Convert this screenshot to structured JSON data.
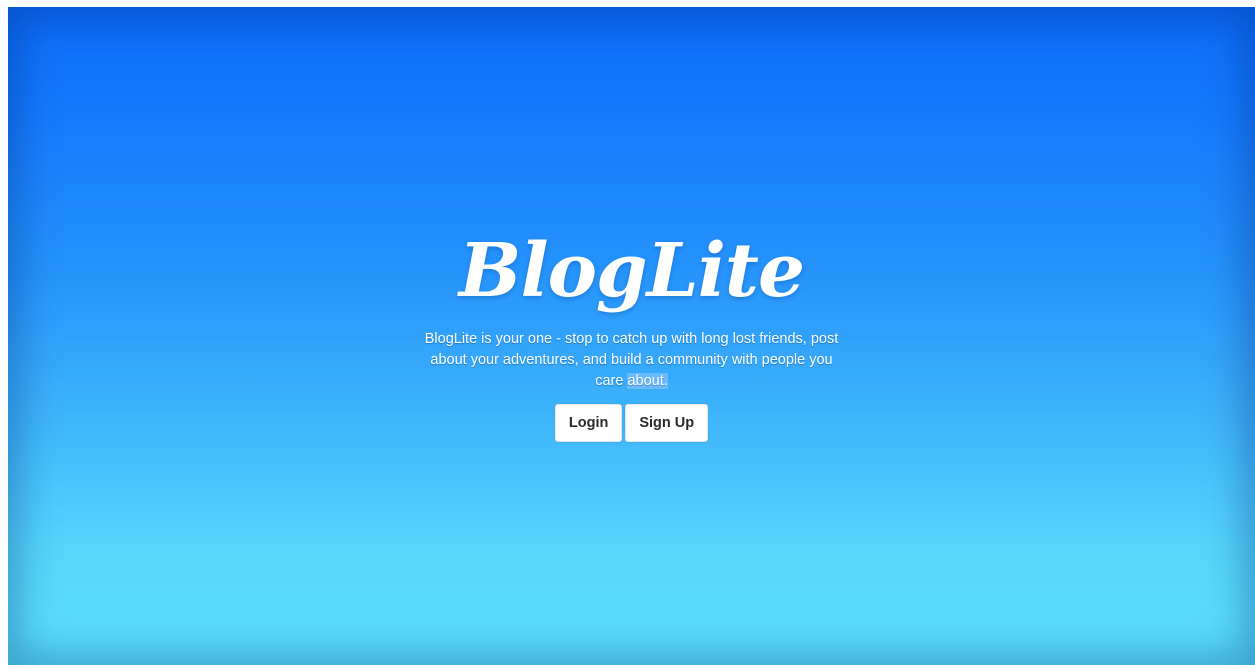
{
  "brand": {
    "logo_text": "BlogLite"
  },
  "hero": {
    "tagline_main": "BlogLite is your one - stop to catch up with long lost friends, post about your adventures, and build a community with people you care",
    "tagline_selected": "about."
  },
  "actions": {
    "login_label": "Login",
    "signup_label": "Sign Up"
  },
  "colors": {
    "gradient_top": "#0c6cfb",
    "gradient_bottom": "#5ce3fd",
    "text": "#ffffff",
    "button_bg": "#ffffff",
    "button_text": "#2a2a2a"
  }
}
